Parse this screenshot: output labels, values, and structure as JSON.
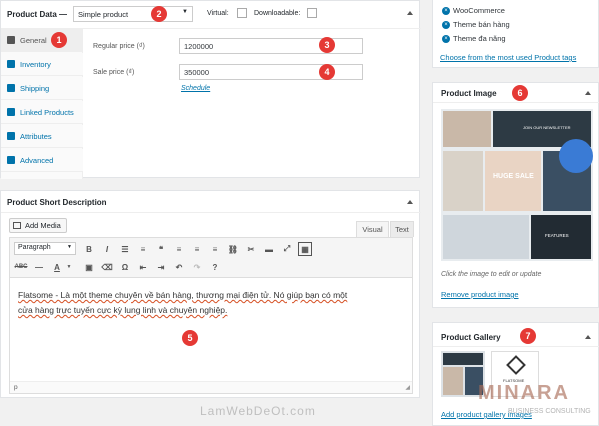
{
  "product_data": {
    "title": "Product Data —",
    "type_value": "Simple product",
    "virtual_label": "Virtual:",
    "downloadable_label": "Downloadable:",
    "tabs": [
      {
        "label": "General"
      },
      {
        "label": "Inventory"
      },
      {
        "label": "Shipping"
      },
      {
        "label": "Linked Products"
      },
      {
        "label": "Attributes"
      },
      {
        "label": "Advanced"
      }
    ],
    "regular_price_label": "Regular price (₫)",
    "regular_price_value": "1200000",
    "sale_price_label": "Sale price (₫)",
    "sale_price_value": "350000",
    "schedule_link": "Schedule"
  },
  "short_description": {
    "title": "Product Short Description",
    "add_media": "Add Media",
    "tab_visual": "Visual",
    "tab_text": "Text",
    "format_select": "Paragraph",
    "content": "Flatsome - Là một theme chuyên về bán hàng, thương mại điện tử. Nó giúp bạn có một cửa hàng trực tuyến cực kỳ lung linh và chuyên nghiệp.",
    "path": "p"
  },
  "categories": {
    "items": [
      "WooCommerce",
      "Theme bán hàng",
      "Theme đa năng"
    ],
    "most_used_link": "Choose from the most used Product tags"
  },
  "product_image": {
    "title": "Product Image",
    "hint": "Click the image to edit or update",
    "remove_link": "Remove product image",
    "thumb_text_1": "JOIN OUR NEWSLETTER",
    "thumb_text_2": "HUGE SALE",
    "thumb_text_3": "FEATURES"
  },
  "product_gallery": {
    "title": "Product Gallery",
    "add_link": "Add product gallery images",
    "thumb_text": "FLATSOME"
  },
  "markers": [
    "1",
    "2",
    "3",
    "4",
    "5",
    "6",
    "7"
  ],
  "watermark": {
    "site": "LamWebDeOt.com",
    "brand": "MINARA",
    "brand_sub": "BUSINESS CONSULTING"
  }
}
